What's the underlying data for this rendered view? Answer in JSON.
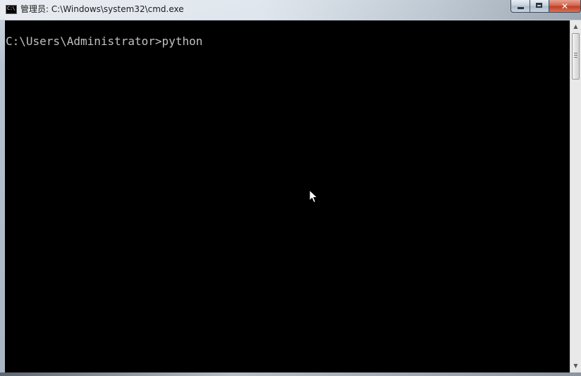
{
  "window": {
    "title": "管理员: C:\\Windows\\system32\\cmd.exe",
    "app_icon_glyph": "C:\\",
    "app_icon": "console-app-icon"
  },
  "caption_buttons": {
    "minimize_icon": "minimize-icon",
    "maximize_icon": "maximize-icon",
    "close_icon": "close-icon",
    "close_glyph": "✕"
  },
  "console": {
    "background": "#000000",
    "text_color": "#c0c0c0",
    "lines": [
      "C:\\Users\\Administrator>python"
    ]
  },
  "scrollbar": {
    "up_glyph": "▲",
    "down_glyph": "▼"
  },
  "colors": {
    "close_button": "#c13f22"
  }
}
